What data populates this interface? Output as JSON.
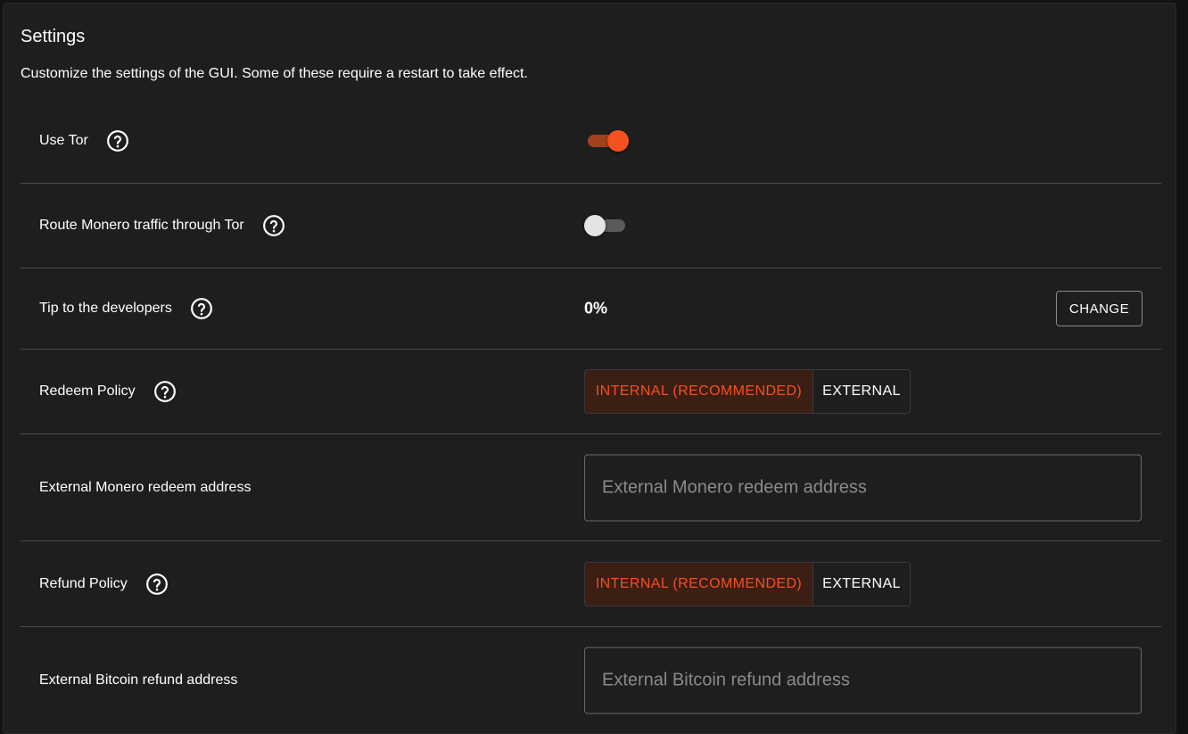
{
  "settings": {
    "title": "Settings",
    "description": "Customize the settings of the GUI. Some of these require a restart to take effect."
  },
  "rows": {
    "use_tor": {
      "label": "Use Tor",
      "enabled": true
    },
    "monero_tor": {
      "label": "Route Monero traffic through Tor",
      "enabled": false
    },
    "tip": {
      "label": "Tip to the developers",
      "value": "0%",
      "button_label": "CHANGE"
    },
    "redeem_policy": {
      "label": "Redeem Policy",
      "options": [
        "INTERNAL (RECOMMENDED)",
        "EXTERNAL"
      ],
      "selected": "INTERNAL (RECOMMENDED)"
    },
    "monero_redeem_address": {
      "label": "External Monero redeem address",
      "placeholder": "External Monero redeem address",
      "value": ""
    },
    "refund_policy": {
      "label": "Refund Policy",
      "options": [
        "INTERNAL (RECOMMENDED)",
        "EXTERNAL"
      ],
      "selected": "INTERNAL (RECOMMENDED)"
    },
    "bitcoin_refund_address": {
      "label": "External Bitcoin refund address",
      "placeholder": "External Bitcoin refund address",
      "value": ""
    }
  },
  "colors": {
    "accent": "#f4511e",
    "accent_track": "#a2401d",
    "selected_bg": "#3b1e14",
    "card_bg": "#1e1e1e",
    "divider": "#4a4a4a"
  },
  "icons": {
    "help": "help-circle-icon"
  }
}
